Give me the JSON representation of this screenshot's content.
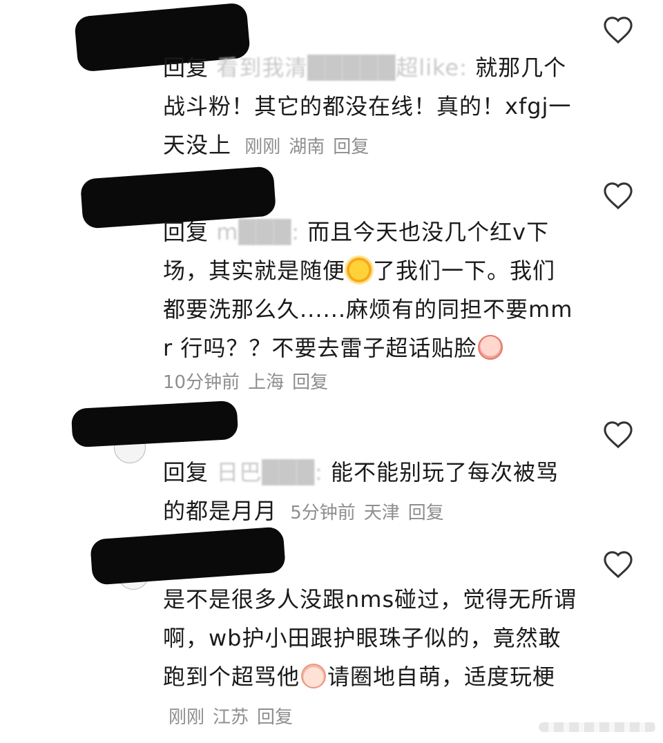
{
  "comments": [
    {
      "reply_prefix": "回复",
      "mention": "看到我清█████超like:",
      "body": "就那几个战斗粉！其它的都没在线！真的！xfgj一天没上",
      "time": "刚刚",
      "location": "湖南",
      "reply_label": "回复",
      "liked": false
    },
    {
      "reply_prefix": "回复",
      "mention": "m███:",
      "body_before_emoji": "而且今天也没几个红v下场，其实就是随便",
      "emoji_1": "sun-emoji",
      "body_mid": "了我们一下。我们都要洗那么久......麻烦有的同担不要mmr 行吗？？不要去雷子超话贴脸",
      "emoji_2": "crying-face-emoji",
      "time": "10分钟前",
      "location": "上海",
      "reply_label": "回复",
      "liked": false
    },
    {
      "reply_prefix": "回复",
      "mention": "日巴███:",
      "body": "能不能别玩了每次被骂的都是月月",
      "time": "5分钟前",
      "location": "天津",
      "reply_label": "回复",
      "liked": false
    },
    {
      "body_before_emoji": "是不是很多人没跟nms碰过，觉得无所谓啊，wb护小田跟护眼珠子似的，竟然敢跑到个超骂他",
      "emoji_1": "cute-face-emoji",
      "body_after_emoji": "请圈地自萌，适度玩梗",
      "time": "刚刚",
      "location": "江苏",
      "reply_label": "回复",
      "liked": false
    }
  ],
  "colors": {
    "text": "#1a1a1a",
    "meta": "#8e8e8e",
    "redaction": "#0a0a0a",
    "heart_outline": "#333333"
  }
}
